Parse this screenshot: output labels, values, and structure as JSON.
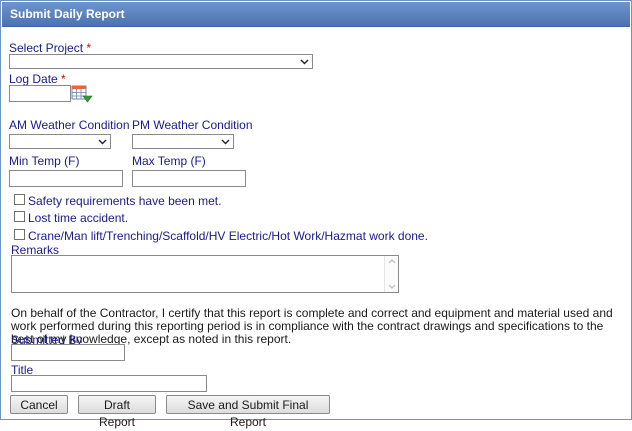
{
  "window": {
    "title": "Submit Daily Report"
  },
  "form": {
    "project": {
      "label": "Select Project",
      "required_mark": "*",
      "value": ""
    },
    "log_date": {
      "label": "Log Date",
      "required_mark": "*",
      "value": ""
    },
    "am_weather": {
      "label": "AM Weather Condition",
      "value": ""
    },
    "pm_weather": {
      "label": "PM Weather Condition",
      "value": ""
    },
    "min_temp": {
      "label": "Min Temp (F)",
      "value": ""
    },
    "max_temp": {
      "label": "Max Temp (F)",
      "value": ""
    },
    "checkboxes": [
      {
        "label": "Safety requirements have been met.",
        "checked": false
      },
      {
        "label": "Lost time accident.",
        "checked": false
      },
      {
        "label": "Crane/Man lift/Trenching/Scaffold/HV Electric/Hot Work/Hazmat work done.",
        "checked": false
      }
    ],
    "remarks": {
      "label": "Remarks",
      "value": ""
    },
    "certification": "On behalf of the Contractor, I certify that this report is complete and correct and equipment and material used and work performed during this reporting period is in compliance with the contract drawings and specifications to the best of my knowledge, except as noted in this report.",
    "submitted_by": {
      "label": "Submitted By",
      "value": ""
    },
    "title_field": {
      "label": "Title",
      "value": ""
    }
  },
  "buttons": {
    "cancel": "Cancel",
    "draft": "Draft Report",
    "submit": "Save and Submit Final Report"
  },
  "icons": {
    "calendar": "calendar-icon",
    "dropdown": "chevron-down-icon"
  },
  "colors": {
    "title_bar": "#5a80bf",
    "label_text": "#1a1a8c",
    "required": "#d40000"
  }
}
